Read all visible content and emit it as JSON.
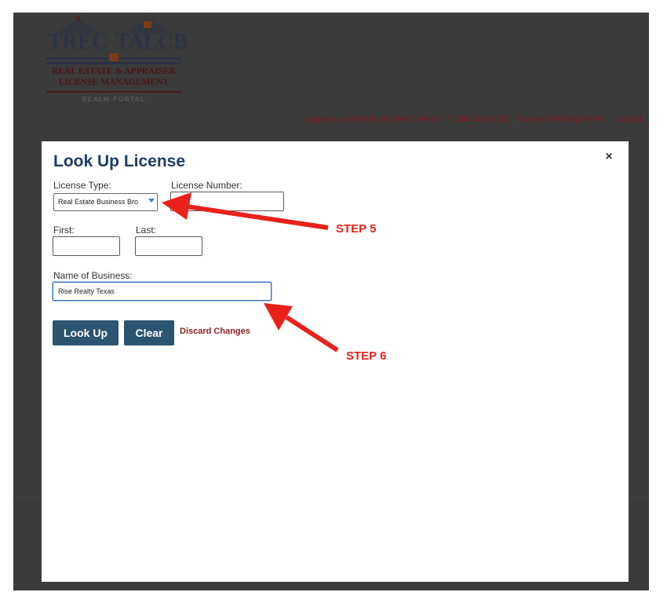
{
  "header": {
    "logo": {
      "word_left": "TREC",
      "word_right": "TALCB",
      "line1": "REAL ESTATE & APPRAISER",
      "line2": "LICENSE MANAGEMENT",
      "portal": "REALM PORTAL"
    },
    "nav": {
      "login_status": "Logged in as:BISHOP, MICHAEL JAMES",
      "collections": "Collections (0)",
      "account": "Account Management",
      "logout": "Logout"
    }
  },
  "modal": {
    "title": "Look Up License",
    "close_symbol": "×",
    "fields": {
      "license_type_label": "License Type:",
      "license_type_value": "Real Estate Business Bro",
      "license_number_label": "License Number:",
      "license_number_value": "",
      "first_label": "First:",
      "first_value": "",
      "last_label": "Last:",
      "last_value": "",
      "business_label": "Name of Business:",
      "business_value": "Rise Realty Texas"
    },
    "buttons": {
      "lookup": "Look Up",
      "clear": "Clear",
      "discard": "Discard Changes"
    }
  },
  "annotations": {
    "step5": "STEP 5",
    "step6": "STEP 6"
  },
  "colors": {
    "modal_title": "#1f3d63",
    "button_bg": "#2a5470",
    "nav_text": "#7a1b1d",
    "annotation": "#e8221b",
    "overlay": "#3b3b3b"
  },
  "icons": {
    "close": "close-icon",
    "select_caret": "chevron-down-icon",
    "arrow": "arrow-icon"
  }
}
